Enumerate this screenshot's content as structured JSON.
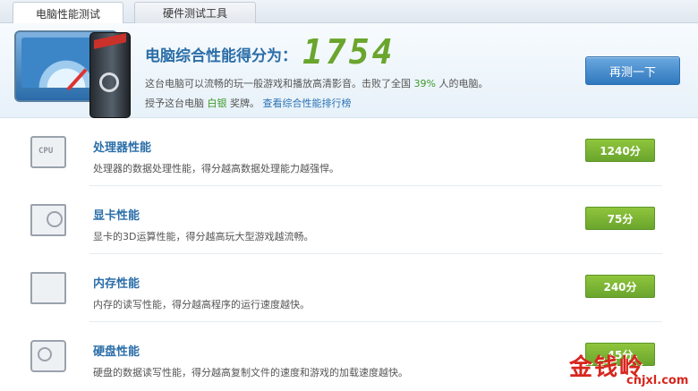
{
  "tabs": [
    {
      "label": "电脑性能测试"
    },
    {
      "label": "硬件测试工具"
    }
  ],
  "hero": {
    "score_title": "电脑综合性能得分为：",
    "score": "1754",
    "desc_line1": "这台电脑可以流畅的玩一般游戏和播放高清影音。击败了全国",
    "beat_percent": "39%",
    "desc_line1_tail": "人的电脑。",
    "award_prefix": "授予这台电脑",
    "award": "白银",
    "award_suffix": "奖牌。",
    "ranking_link": "查看综合性能排行榜",
    "retest_button": "再测一下"
  },
  "items": [
    {
      "title": "处理器性能",
      "desc": "处理器的数据处理性能，得分越高数据处理能力越强悍。",
      "score": "1240分",
      "icon": "cpu-icon",
      "icon_text": "CPU"
    },
    {
      "title": "显卡性能",
      "desc": "显卡的3D运算性能，得分越高玩大型游戏越流畅。",
      "score": "75分",
      "icon": "graphics-card-icon"
    },
    {
      "title": "内存性能",
      "desc": "内存的读写性能，得分越高程序的运行速度越快。",
      "score": "240分",
      "icon": "memory-icon"
    },
    {
      "title": "硬盘性能",
      "desc": "硬盘的数据读写性能，得分越高复制文件的速度和游戏的加载速度越快。",
      "score": "45分",
      "icon": "hard-disk-icon"
    }
  ],
  "watermark": {
    "main": "金钱岭",
    "sub": "cnjxl.com"
  },
  "colors": {
    "accent_blue": "#2b6ea8",
    "score_green": "#6aa52d",
    "badge_green": "#7cb537",
    "watermark_red": "#d7261e"
  }
}
